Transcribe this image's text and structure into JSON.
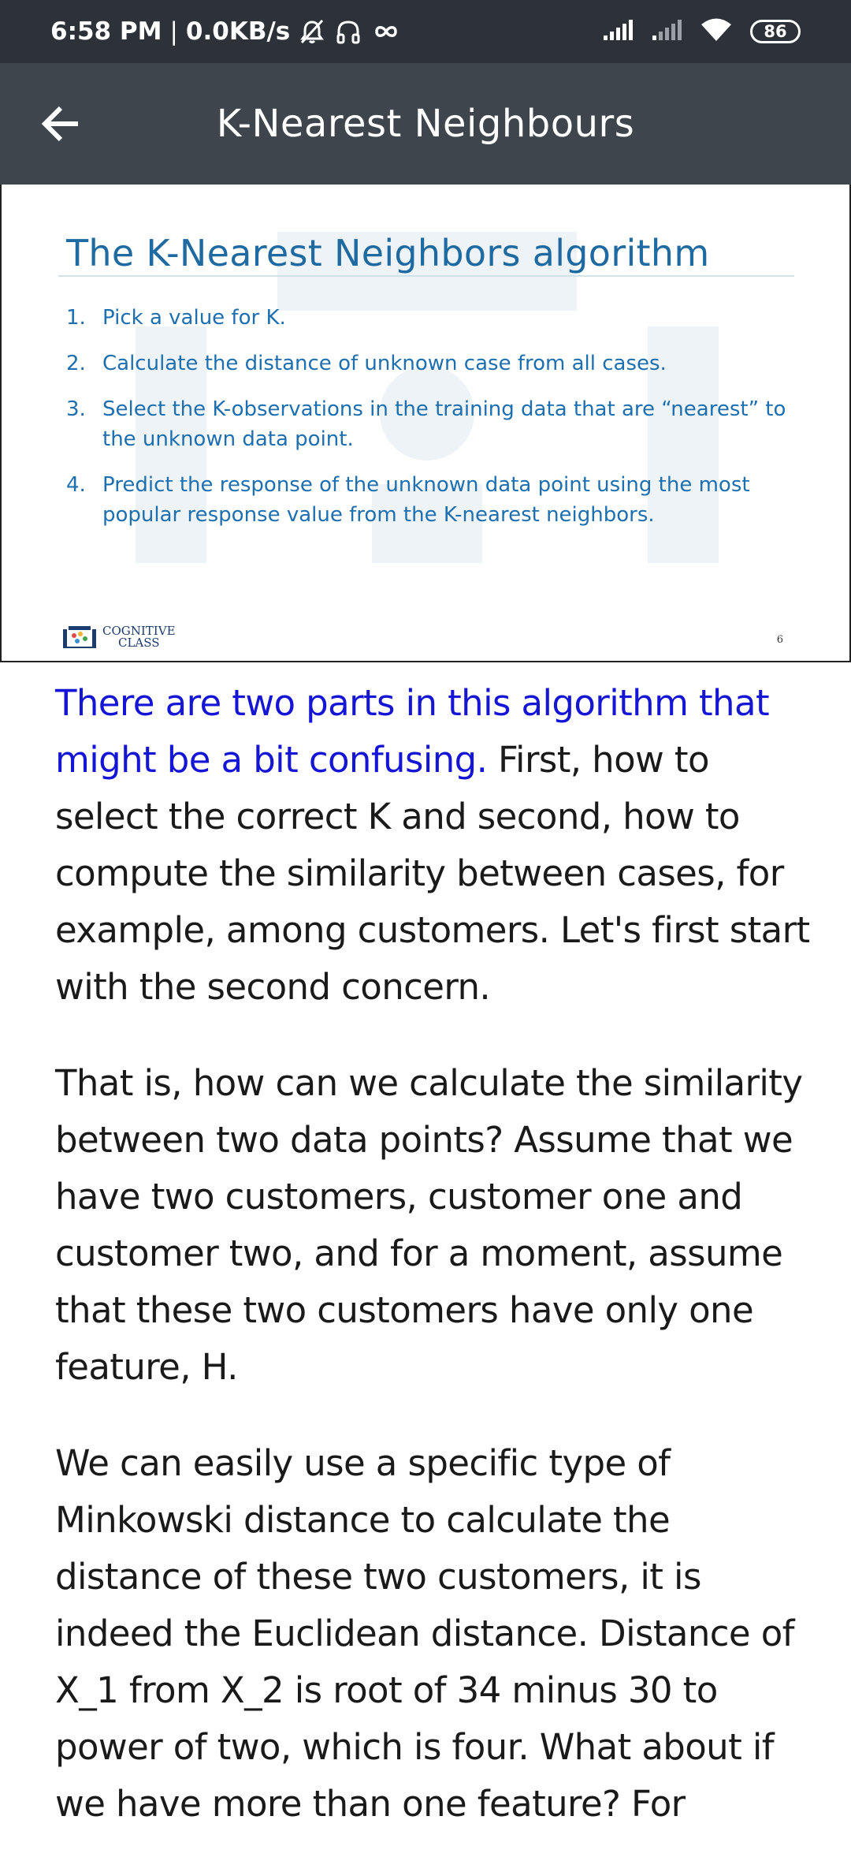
{
  "status_bar": {
    "time": "6:58 PM",
    "separator": "|",
    "speed": "0.0KB/s",
    "battery": "86",
    "icons": [
      "alarm-off-icon",
      "headset-icon",
      "infinity-icon",
      "signal-icon",
      "signal-icon-2",
      "wifi-icon",
      "battery-icon"
    ]
  },
  "app_bar": {
    "title": "K-Nearest Neighbours",
    "back_icon": "arrow-left-icon"
  },
  "slide": {
    "heading": "The K-Nearest Neighbors algorithm",
    "items": [
      {
        "num": "1.",
        "text": "Pick a value for K."
      },
      {
        "num": "2.",
        "text": "Calculate the distance of unknown case from all cases."
      },
      {
        "num": "3.",
        "text": "Select the K-observations in the training data that are “nearest” to the unknown data point."
      },
      {
        "num": "4.",
        "text": "Predict the response of the unknown data point using the most popular response value from the K-nearest neighbors."
      }
    ],
    "logo_line1": "COGNITIVE",
    "logo_line2": "CLASS",
    "page_number": "6"
  },
  "transcript": {
    "p1_highlight": "There are two parts in this algorithm that might be a bit confusing.",
    "p1_rest": " First, how to select the correct K and second, how to compute the similarity between cases, for example, among customers. Let's first start with the second concern.",
    "p2": "That is, how can we calculate the similarity between two data points? Assume that we have two customers, customer one and customer two, and for a moment, assume that these two customers have only one feature, H.",
    "p3": "We can easily use a specific type of Minkowski distance to calculate the distance of these two customers, it is indeed the Euclidean distance. Distance of X_1 from X_2 is root of 34 minus 30 to power of two, which is four. What about if we have more than one feature? For"
  },
  "colors": {
    "status_bar_bg": "#2d3238",
    "app_bar_bg": "#3f454c",
    "slide_heading": "#1f6aa0",
    "slide_text": "#1d6fb0",
    "highlight_text": "#1515d6",
    "body_text": "#1a1a1a"
  }
}
